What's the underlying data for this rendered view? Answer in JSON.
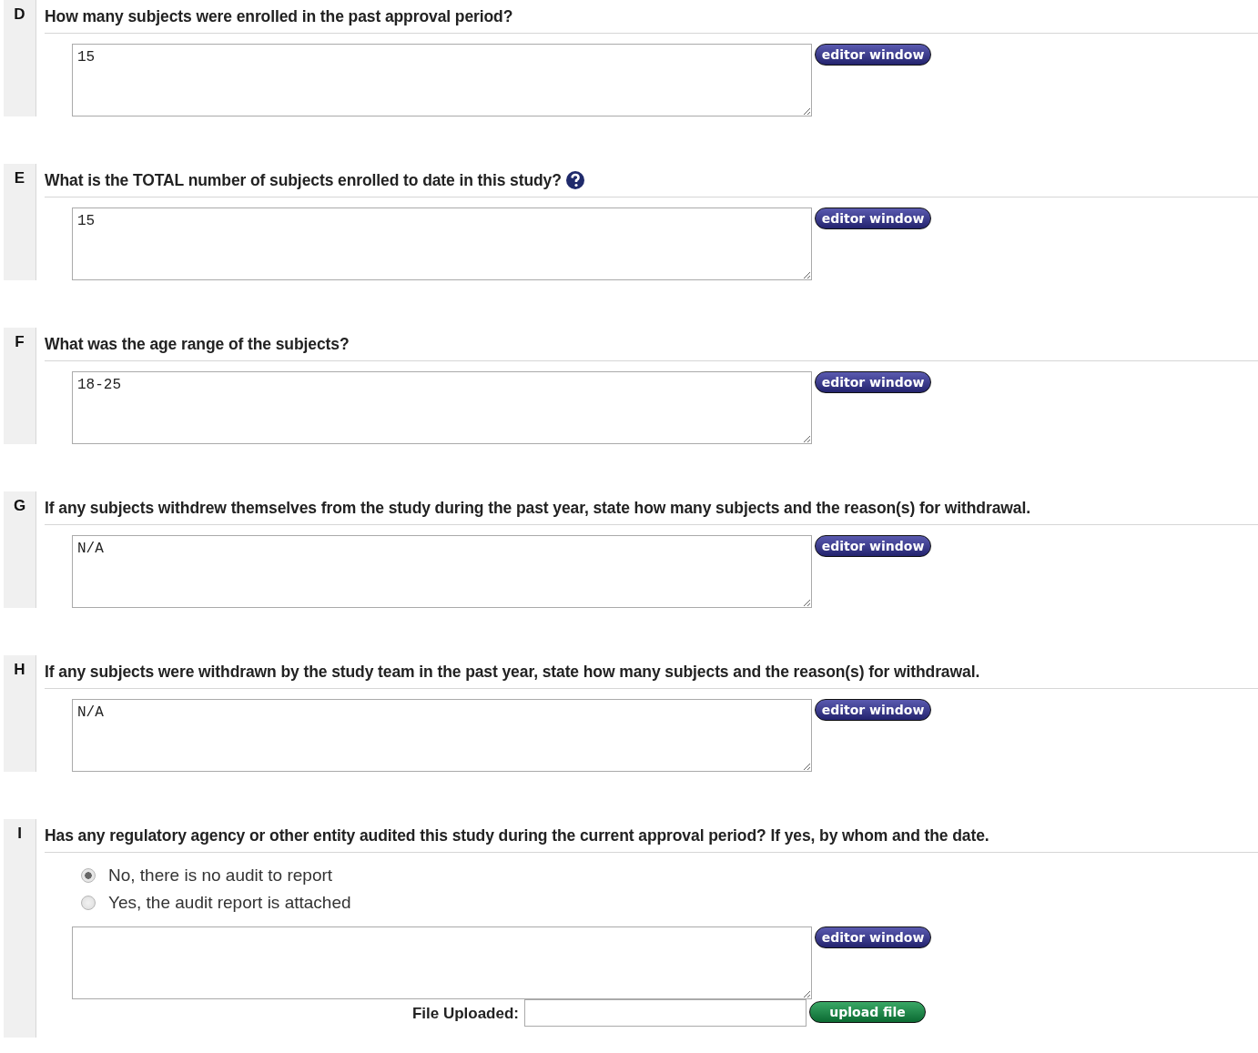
{
  "sections": [
    {
      "kind": "text",
      "letter": "D",
      "question": "How many subjects were enrolled in the past approval period?",
      "help": false,
      "answer": "15",
      "button": "editor window"
    },
    {
      "kind": "text",
      "letter": "E",
      "question": "What is the TOTAL number of subjects enrolled to date in this study?",
      "help": true,
      "answer": "15",
      "button": "editor window"
    },
    {
      "kind": "text",
      "letter": "F",
      "question": "What was the age range of the subjects?",
      "help": false,
      "answer": "18-25",
      "button": "editor window"
    },
    {
      "kind": "text",
      "letter": "G",
      "question": "If any subjects withdrew themselves from the study during the past year, state how many subjects and the reason(s) for withdrawal.",
      "help": false,
      "answer": "N/A",
      "button": "editor window"
    },
    {
      "kind": "text",
      "letter": "H",
      "question": "If any subjects were withdrawn by the study team in the past year, state how many subjects and the reason(s) for withdrawal.",
      "help": false,
      "answer": "N/A",
      "button": "editor window"
    },
    {
      "kind": "radio",
      "letter": "I",
      "question": "Has any regulatory agency or other entity audited this study during the current approval period? If yes, by whom and the date.",
      "help": false,
      "options": [
        {
          "label": "No, there is no audit to report",
          "selected": true
        },
        {
          "label": "Yes, the audit report is attached",
          "selected": false
        }
      ],
      "button": "editor window",
      "file_label": "File Uploaded:",
      "upload_button": "upload file"
    }
  ]
}
